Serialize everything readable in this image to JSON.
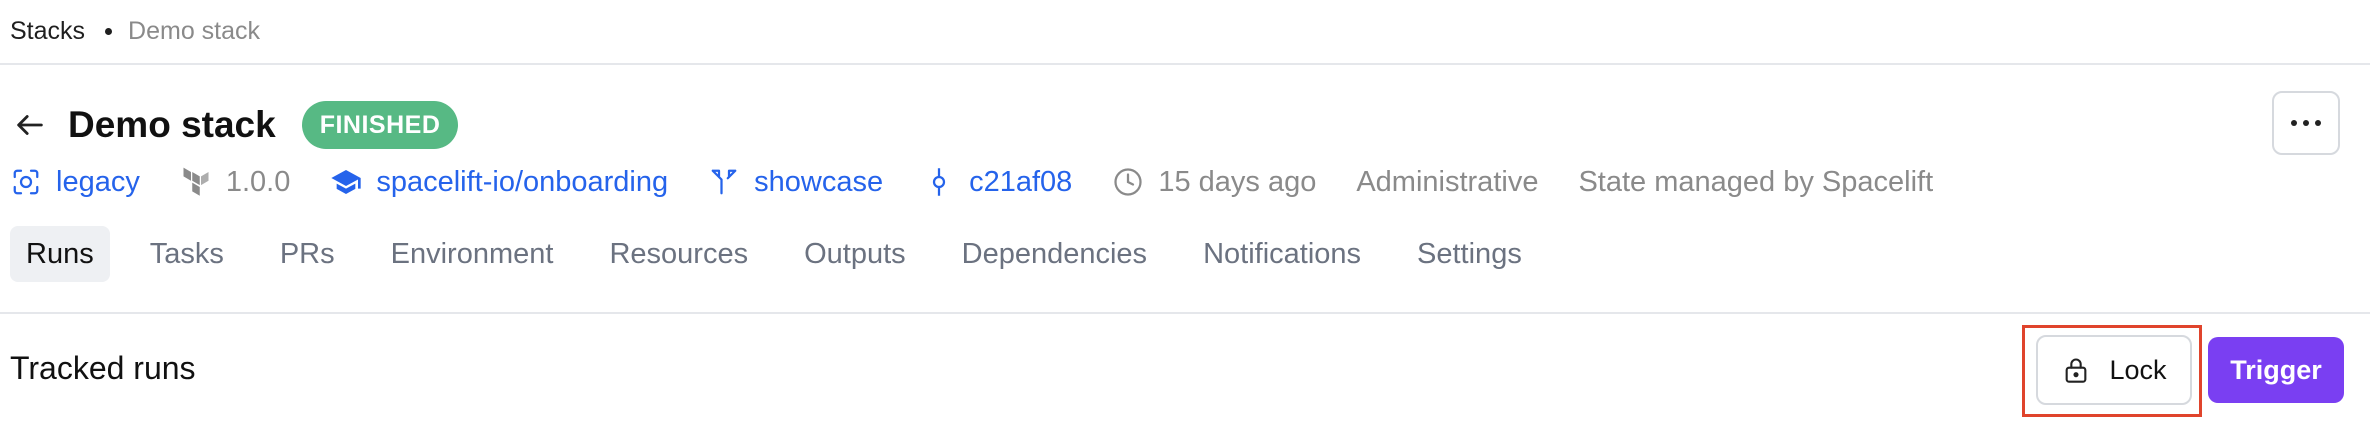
{
  "breadcrumb": {
    "root": "Stacks",
    "current": "Demo stack"
  },
  "header": {
    "title": "Demo stack",
    "status": "FINISHED"
  },
  "meta": {
    "space": "legacy",
    "version": "1.0.0",
    "repository": "spacelift-io/onboarding",
    "branch": "showcase",
    "commit": "c21af08",
    "updated": "15 days ago",
    "administrative": "Administrative",
    "state": "State managed by Spacelift"
  },
  "tabs": [
    "Runs",
    "Tasks",
    "PRs",
    "Environment",
    "Resources",
    "Outputs",
    "Dependencies",
    "Notifications",
    "Settings"
  ],
  "section": {
    "title": "Tracked runs"
  },
  "actions": {
    "lock_label": "Lock",
    "trigger_label": "Trigger"
  },
  "colors": {
    "link": "#2563eb",
    "status": "#57b984",
    "accent": "#7a3ff2",
    "highlight": "#e0442c"
  }
}
